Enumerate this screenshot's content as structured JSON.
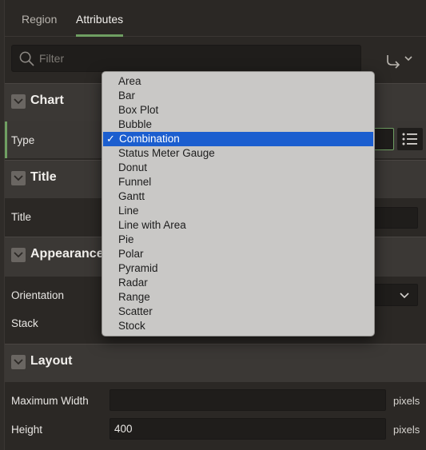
{
  "tabs": [
    {
      "label": "Region",
      "active": false
    },
    {
      "label": "Attributes",
      "active": true
    }
  ],
  "filter": {
    "placeholder": "Filter",
    "value": ""
  },
  "accent_color": "#6f9f62",
  "sections": {
    "chart": {
      "title": "Chart",
      "type_label": "Type"
    },
    "title": {
      "title": "Title",
      "title_label": "Title"
    },
    "appearance": {
      "title": "Appearance",
      "orientation_label": "Orientation",
      "stack_label": "Stack"
    },
    "layout": {
      "title": "Layout",
      "max_width_label": "Maximum Width",
      "max_width_value": "",
      "max_width_suffix": "pixels",
      "height_label": "Height",
      "height_value": "400",
      "height_suffix": "pixels"
    }
  },
  "type_dropdown": {
    "selected": "Combination",
    "check_glyph": "✓",
    "options": [
      "Area",
      "Bar",
      "Box Plot",
      "Bubble",
      "Combination",
      "Status Meter Gauge",
      "Donut",
      "Funnel",
      "Gantt",
      "Line",
      "Line with Area",
      "Pie",
      "Polar",
      "Pyramid",
      "Radar",
      "Range",
      "Scatter",
      "Stock"
    ]
  },
  "icons": {
    "filter": "search-icon",
    "go_menu": "go-to-arrow-icon",
    "collapse": "chevron-down-icon",
    "list": "list-icon"
  }
}
